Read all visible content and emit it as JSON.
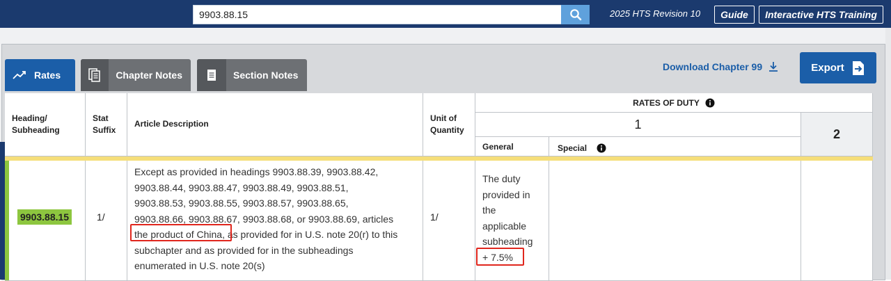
{
  "header": {
    "search_value": "9903.88.15",
    "search_icon": "search-icon",
    "revision": "2025 HTS Revision 10",
    "guide_label": "Guide",
    "training_label": "Interactive HTS Training"
  },
  "tabs": [
    {
      "label": "Rates",
      "icon": "trend-icon",
      "active": true
    },
    {
      "label": "Chapter Notes",
      "icon": "documents-icon",
      "active": false
    },
    {
      "label": "Section Notes",
      "icon": "document-icon",
      "active": false
    }
  ],
  "toolbar": {
    "download_label": "Download Chapter 99",
    "download_icon": "download-icon",
    "export_label": "Export",
    "export_icon": "export-icon"
  },
  "table": {
    "headers": {
      "heading": "Heading/ Subheading",
      "stat_suffix": "Stat Suffix",
      "description": "Article Description",
      "unit": "Unit of Quantity",
      "rates": "RATES OF DUTY",
      "col1": "1",
      "general": "General",
      "special": "Special",
      "col2": "2"
    },
    "row": {
      "heading": "9903.88.15",
      "stat_suffix": "1/",
      "description_lines": [
        "Except as provided in headings 9903.88.39, 9903.88.42,",
        "9903.88.44, 9903.88.47, 9903.88.49, 9903.88.51,",
        "9903.88.53, 9903.88.55, 9903.88.57, 9903.88.65,",
        "9903.88.66, 9903.88.67, 9903.88.68, or 9903.88.69, articles"
      ],
      "description_highlight": "the product of China,",
      "description_after_highlight": " as provided for in U.S. note 20(r) to this",
      "description_tail": [
        "subchapter and as provided for in the subheadings",
        "enumerated in U.S. note 20(s)"
      ],
      "unit": "1/",
      "general_lines": [
        "The duty",
        "provided in",
        "the",
        "applicable",
        "subheading"
      ],
      "general_rate": "+ 7.5%",
      "special": "",
      "col2": ""
    }
  },
  "colors": {
    "navy": "#1b3a6e",
    "accent_blue": "#1b5ea8",
    "tab_gray": "#6d7074",
    "highlight_green": "#8dc63f",
    "divider_yellow": "#f5de7a",
    "annotation_red": "#e0261d"
  }
}
